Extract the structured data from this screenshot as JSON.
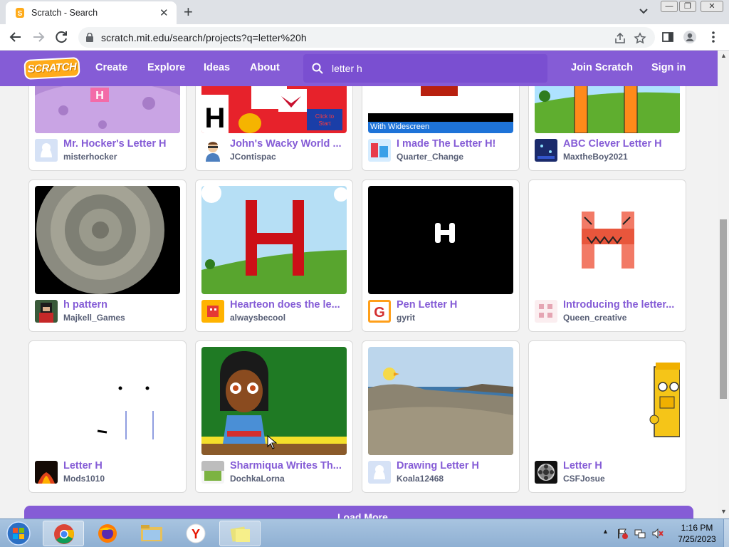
{
  "browser": {
    "tab_title": "Scratch - Search",
    "url": "scratch.mit.edu/search/projects?q=letter%20h"
  },
  "nav": {
    "logo": "SCRATCH",
    "create": "Create",
    "explore": "Explore",
    "ideas": "Ideas",
    "about": "About",
    "search_value": "letter h",
    "join": "Join Scratch",
    "signin": "Sign in"
  },
  "projects": [
    {
      "title": "Mr. Hocker's Letter H",
      "author": "misterhocker"
    },
    {
      "title": "John's Wacky World ...",
      "author": "JContispac"
    },
    {
      "title": "I made The Letter H!",
      "author": "Quarter_Change",
      "thumb_caption": "With Widescreen"
    },
    {
      "title": "ABC Clever Letter H",
      "author": "MaxtheBoy2021"
    },
    {
      "title": "h pattern",
      "author": "Majkell_Games"
    },
    {
      "title": "Hearteon does the le...",
      "author": "alwaysbecool"
    },
    {
      "title": "Pen Letter H",
      "author": "gyrit"
    },
    {
      "title": "Introducing the letter...",
      "author": "Queen_creative"
    },
    {
      "title": "Letter H",
      "author": "Mods1010"
    },
    {
      "title": "Sharmiqua Writes Th...",
      "author": "DochkaLorna"
    },
    {
      "title": "Drawing Letter H",
      "author": "Koala12468"
    },
    {
      "title": "Letter H",
      "author": "CSFJosue"
    }
  ],
  "load_more": "Load More",
  "taskbar": {
    "time": "1:16 PM",
    "date": "7/25/2023"
  },
  "colors": {
    "scratch_purple": "#855cd6",
    "logo_orange": "#ffab1a"
  }
}
